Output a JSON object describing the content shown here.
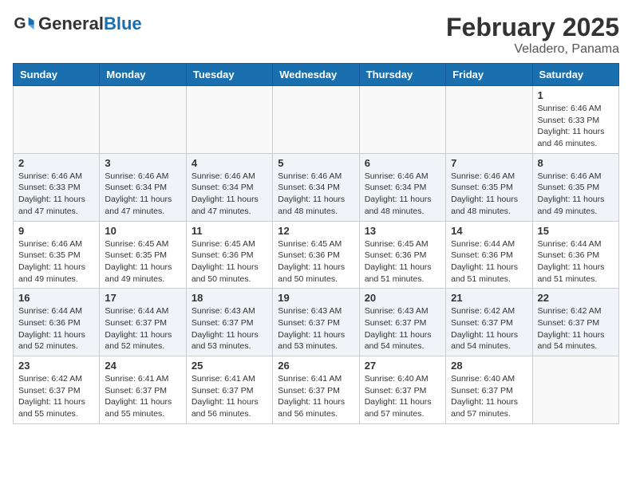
{
  "header": {
    "logo_general": "General",
    "logo_blue": "Blue",
    "month_title": "February 2025",
    "subtitle": "Veladero, Panama"
  },
  "weekdays": [
    "Sunday",
    "Monday",
    "Tuesday",
    "Wednesday",
    "Thursday",
    "Friday",
    "Saturday"
  ],
  "weeks": [
    [
      {
        "day": "",
        "info": ""
      },
      {
        "day": "",
        "info": ""
      },
      {
        "day": "",
        "info": ""
      },
      {
        "day": "",
        "info": ""
      },
      {
        "day": "",
        "info": ""
      },
      {
        "day": "",
        "info": ""
      },
      {
        "day": "1",
        "info": "Sunrise: 6:46 AM\nSunset: 6:33 PM\nDaylight: 11 hours and 46 minutes."
      }
    ],
    [
      {
        "day": "2",
        "info": "Sunrise: 6:46 AM\nSunset: 6:33 PM\nDaylight: 11 hours and 47 minutes."
      },
      {
        "day": "3",
        "info": "Sunrise: 6:46 AM\nSunset: 6:34 PM\nDaylight: 11 hours and 47 minutes."
      },
      {
        "day": "4",
        "info": "Sunrise: 6:46 AM\nSunset: 6:34 PM\nDaylight: 11 hours and 47 minutes."
      },
      {
        "day": "5",
        "info": "Sunrise: 6:46 AM\nSunset: 6:34 PM\nDaylight: 11 hours and 48 minutes."
      },
      {
        "day": "6",
        "info": "Sunrise: 6:46 AM\nSunset: 6:34 PM\nDaylight: 11 hours and 48 minutes."
      },
      {
        "day": "7",
        "info": "Sunrise: 6:46 AM\nSunset: 6:35 PM\nDaylight: 11 hours and 48 minutes."
      },
      {
        "day": "8",
        "info": "Sunrise: 6:46 AM\nSunset: 6:35 PM\nDaylight: 11 hours and 49 minutes."
      }
    ],
    [
      {
        "day": "9",
        "info": "Sunrise: 6:46 AM\nSunset: 6:35 PM\nDaylight: 11 hours and 49 minutes."
      },
      {
        "day": "10",
        "info": "Sunrise: 6:45 AM\nSunset: 6:35 PM\nDaylight: 11 hours and 49 minutes."
      },
      {
        "day": "11",
        "info": "Sunrise: 6:45 AM\nSunset: 6:36 PM\nDaylight: 11 hours and 50 minutes."
      },
      {
        "day": "12",
        "info": "Sunrise: 6:45 AM\nSunset: 6:36 PM\nDaylight: 11 hours and 50 minutes."
      },
      {
        "day": "13",
        "info": "Sunrise: 6:45 AM\nSunset: 6:36 PM\nDaylight: 11 hours and 51 minutes."
      },
      {
        "day": "14",
        "info": "Sunrise: 6:44 AM\nSunset: 6:36 PM\nDaylight: 11 hours and 51 minutes."
      },
      {
        "day": "15",
        "info": "Sunrise: 6:44 AM\nSunset: 6:36 PM\nDaylight: 11 hours and 51 minutes."
      }
    ],
    [
      {
        "day": "16",
        "info": "Sunrise: 6:44 AM\nSunset: 6:36 PM\nDaylight: 11 hours and 52 minutes."
      },
      {
        "day": "17",
        "info": "Sunrise: 6:44 AM\nSunset: 6:37 PM\nDaylight: 11 hours and 52 minutes."
      },
      {
        "day": "18",
        "info": "Sunrise: 6:43 AM\nSunset: 6:37 PM\nDaylight: 11 hours and 53 minutes."
      },
      {
        "day": "19",
        "info": "Sunrise: 6:43 AM\nSunset: 6:37 PM\nDaylight: 11 hours and 53 minutes."
      },
      {
        "day": "20",
        "info": "Sunrise: 6:43 AM\nSunset: 6:37 PM\nDaylight: 11 hours and 54 minutes."
      },
      {
        "day": "21",
        "info": "Sunrise: 6:42 AM\nSunset: 6:37 PM\nDaylight: 11 hours and 54 minutes."
      },
      {
        "day": "22",
        "info": "Sunrise: 6:42 AM\nSunset: 6:37 PM\nDaylight: 11 hours and 54 minutes."
      }
    ],
    [
      {
        "day": "23",
        "info": "Sunrise: 6:42 AM\nSunset: 6:37 PM\nDaylight: 11 hours and 55 minutes."
      },
      {
        "day": "24",
        "info": "Sunrise: 6:41 AM\nSunset: 6:37 PM\nDaylight: 11 hours and 55 minutes."
      },
      {
        "day": "25",
        "info": "Sunrise: 6:41 AM\nSunset: 6:37 PM\nDaylight: 11 hours and 56 minutes."
      },
      {
        "day": "26",
        "info": "Sunrise: 6:41 AM\nSunset: 6:37 PM\nDaylight: 11 hours and 56 minutes."
      },
      {
        "day": "27",
        "info": "Sunrise: 6:40 AM\nSunset: 6:37 PM\nDaylight: 11 hours and 57 minutes."
      },
      {
        "day": "28",
        "info": "Sunrise: 6:40 AM\nSunset: 6:37 PM\nDaylight: 11 hours and 57 minutes."
      },
      {
        "day": "",
        "info": ""
      }
    ]
  ]
}
